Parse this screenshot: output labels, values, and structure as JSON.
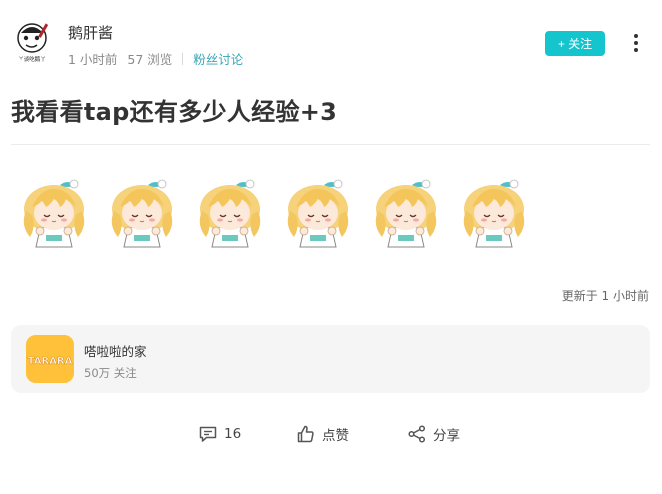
{
  "post": {
    "author": {
      "name": "鹅肝酱",
      "avatar_caption": "丫谈吃鹅丫"
    },
    "time": "1 小时前",
    "views": "57 浏览",
    "forum": "粉丝讨论",
    "follow_label": "+ 关注",
    "title": "我看看tap还有多少人经验+3",
    "stickers": [
      "sticker-1",
      "sticker-2",
      "sticker-3",
      "sticker-4",
      "sticker-5",
      "sticker-6"
    ],
    "updated": "更新于 1 小时前"
  },
  "group": {
    "logo_text": "TARARA",
    "name": "嗒啦啦的家",
    "followers": "50万 关注"
  },
  "actions": {
    "comments": "16",
    "like_label": "点赞",
    "share_label": "分享"
  },
  "colors": {
    "accent": "#15c5ce",
    "forum_link": "#3aa5b6",
    "group_logo_bg": "#ffc13a"
  }
}
